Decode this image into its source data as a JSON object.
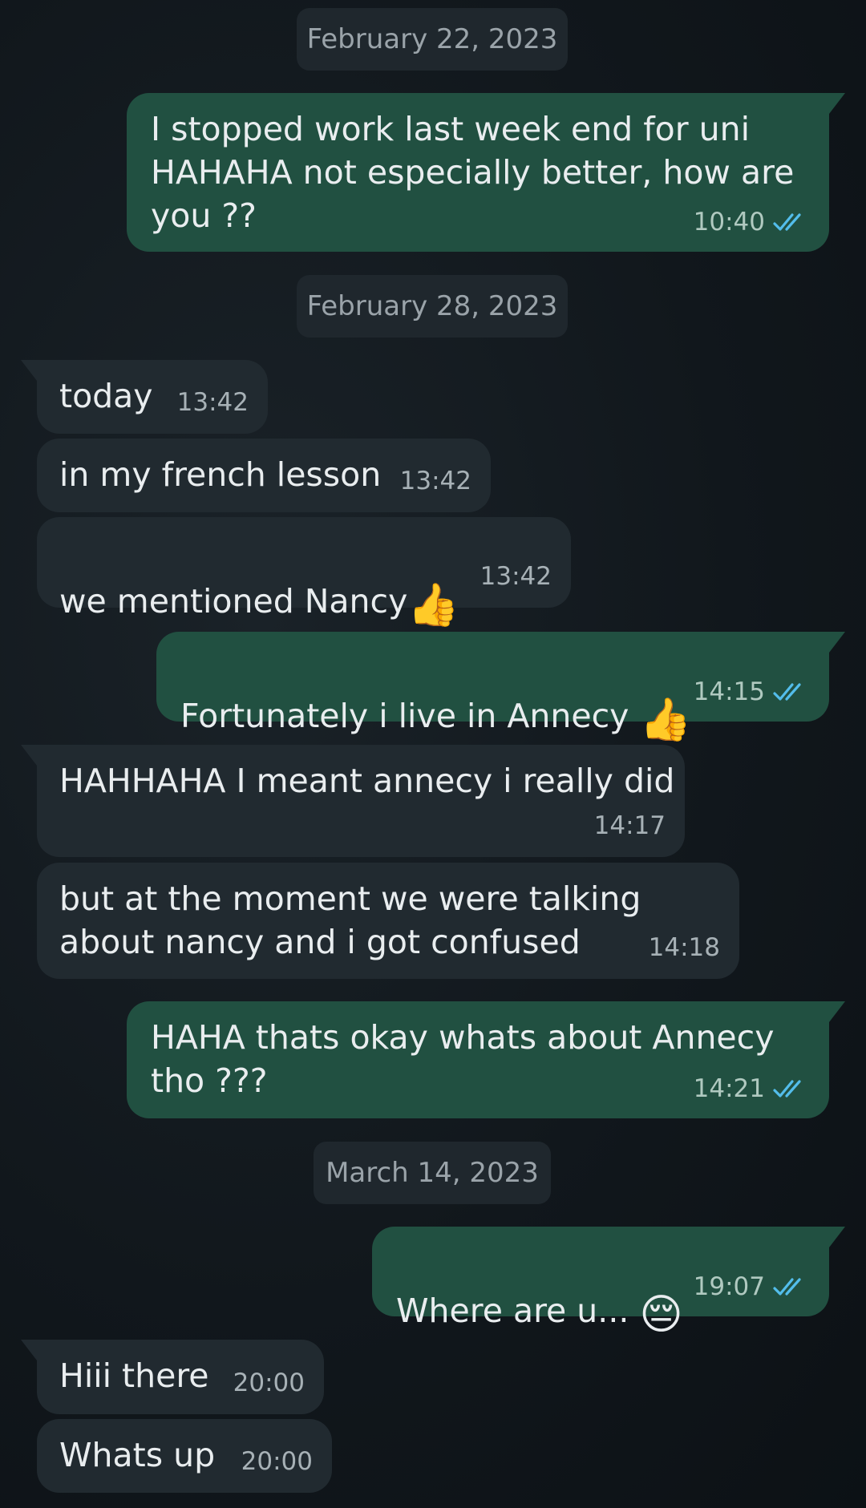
{
  "dates": [
    "February 22, 2023",
    "February 28, 2023",
    "March 14, 2023"
  ],
  "messages": [
    {
      "dir": "out",
      "text": "I stopped work last week end for uni\nHAHAHA not especially better, how are\nyou ??",
      "time": "10:40",
      "status": "read"
    },
    {
      "dir": "in",
      "text": "today",
      "time": "13:42"
    },
    {
      "dir": "in",
      "text": "in my french lesson",
      "time": "13:42"
    },
    {
      "dir": "in",
      "text": "we mentioned Nancy",
      "emoji": "👍",
      "time": "13:42"
    },
    {
      "dir": "out",
      "text": "Fortunately i live in Annecy ",
      "emoji": "👍",
      "time": "14:15",
      "status": "read"
    },
    {
      "dir": "in",
      "text": "HAHHAHA I meant annecy i really did",
      "time": "14:17"
    },
    {
      "dir": "in",
      "text": "but at the moment we were talking\nabout nancy and i got confused",
      "time": "14:18"
    },
    {
      "dir": "out",
      "text": "HAHA thats okay whats about Annecy\ntho ???",
      "time": "14:21",
      "status": "read"
    },
    {
      "dir": "out",
      "text": "Where are u... ",
      "emoji": "😔",
      "time": "19:07",
      "status": "read"
    },
    {
      "dir": "in",
      "text": "Hiii there",
      "time": "20:00"
    },
    {
      "dir": "in",
      "text": "Whats up",
      "time": "20:00"
    }
  ],
  "colors": {
    "incoming_bubble": "#212a30",
    "outgoing_bubble": "#215041",
    "read_ticks": "#53bdeb",
    "date_pill": "#1f272d"
  },
  "icons": {
    "read_status": "double-check-icon"
  }
}
